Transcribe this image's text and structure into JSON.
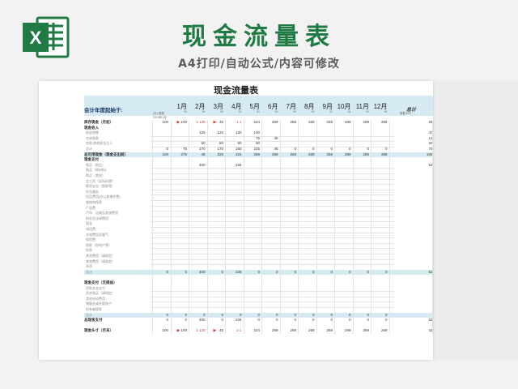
{
  "header": {
    "title": "现金流量表",
    "subtitle": "A4打印/自动公式/内容可修改"
  },
  "sheet": {
    "title": "现金流量表",
    "year_label": "会计年度起始于:",
    "year_sub": "2019年1月",
    "start_col_label": "(月) 数据",
    "start_col_sub": "EST",
    "total_label": "总计",
    "total_sub": "数额 EST",
    "months": [
      "1月",
      "2月",
      "3月",
      "4月",
      "5月",
      "6月",
      "7月",
      "8月",
      "9月",
      "10月",
      "11月",
      "12月"
    ],
    "month_sub": "01",
    "rows": [
      {
        "label": "库存现金（月初）",
        "type": "bold",
        "start": "100",
        "vals": [
          "100",
          "1-125",
          "45",
          "1-1",
          "224",
          "269",
          "269",
          "269",
          "269",
          "269",
          "269",
          "269"
        ],
        "total": "269",
        "red": [
          1,
          3
        ],
        "band": false
      },
      {
        "label": "现金收入",
        "type": "bold",
        "start": "",
        "vals": [],
        "total": "",
        "band": false
      },
      {
        "label": "现金销售",
        "type": "ind",
        "start": "",
        "vals": [
          "",
          "125",
          "120",
          "130",
          "100",
          "",
          "",
          "",
          "",
          "",
          "",
          ""
        ],
        "total": "475",
        "band": false
      },
      {
        "label": "应收账款",
        "type": "ind",
        "start": "",
        "vals": [
          "",
          "",
          "",
          "",
          "75",
          "45",
          "",
          "",
          "",
          "",
          "",
          ""
        ],
        "total": "120",
        "band": false
      },
      {
        "label": "贷款/其他现金注入",
        "type": "ind",
        "start": "",
        "vals": [
          "",
          "50",
          "50",
          "50",
          "50",
          "",
          "",
          "",
          "",
          "",
          "",
          ""
        ],
        "total": "200",
        "band": false
      },
      {
        "label": "总计",
        "type": "ind",
        "start": "0",
        "vals": [
          "75",
          "170",
          "170",
          "160",
          "225",
          "45",
          "0",
          "0",
          "0",
          "0",
          "0",
          "0"
        ],
        "total": "795",
        "band": false
      },
      {
        "label": "总可用现金（现金支出前）",
        "type": "bold",
        "start": "100",
        "vals": [
          "275",
          "45",
          "225",
          "224",
          "269",
          "269",
          "269",
          "269",
          "269",
          "269",
          "269",
          "269"
        ],
        "total": "1064",
        "band": true
      },
      {
        "label": "现金支付",
        "type": "bold",
        "start": "",
        "vals": [],
        "total": "",
        "band": false
      },
      {
        "label": "购买（商品）",
        "type": "ind",
        "start": "",
        "vals": [
          "",
          "400",
          "",
          "226",
          "",
          "",
          "",
          "",
          "",
          "",
          "",
          ""
        ],
        "total": "626",
        "band": false
      },
      {
        "label": "购买（原材料）",
        "type": "ind",
        "start": "",
        "vals": [],
        "total": "0",
        "band": false
      },
      {
        "label": "购买（其他）",
        "type": "ind",
        "start": "",
        "vals": [],
        "total": "0",
        "band": false
      },
      {
        "label": "总工资（实际扣除）",
        "type": "ind",
        "start": "",
        "vals": [],
        "total": "0",
        "band": false
      },
      {
        "label": "薪资支出（税款等）",
        "type": "ind",
        "start": "",
        "vals": [],
        "total": "0",
        "band": false
      },
      {
        "label": "外包服务",
        "type": "ind",
        "start": "",
        "vals": [],
        "total": "0",
        "band": false
      },
      {
        "label": "用品费用(办公和操作费)",
        "type": "ind",
        "start": "",
        "vals": [],
        "total": "0",
        "band": false
      },
      {
        "label": "维修和保养",
        "type": "ind",
        "start": "",
        "vals": [],
        "total": "0",
        "band": false
      },
      {
        "label": "广告费",
        "type": "ind",
        "start": "",
        "vals": [],
        "total": "0",
        "band": false
      },
      {
        "label": "汽车、运输及差旅费用",
        "type": "ind",
        "start": "",
        "vals": [],
        "total": "0",
        "band": false
      },
      {
        "label": "财务及法律费用",
        "type": "ind",
        "start": "",
        "vals": [],
        "total": "0",
        "band": false
      },
      {
        "label": "租金",
        "type": "ind",
        "start": "",
        "vals": [],
        "total": "0",
        "band": false
      },
      {
        "label": "电话费",
        "type": "ind",
        "start": "",
        "vals": [],
        "total": "0",
        "band": false
      },
      {
        "label": "水电费用及暖气",
        "type": "ind",
        "start": "",
        "vals": [],
        "total": "0",
        "band": false
      },
      {
        "label": "保险费",
        "type": "ind",
        "start": "",
        "vals": [],
        "total": "0",
        "band": false
      },
      {
        "label": "税款（房地产等）",
        "type": "ind",
        "start": "",
        "vals": [],
        "total": "0",
        "band": false
      },
      {
        "label": "利息",
        "type": "ind",
        "start": "",
        "vals": [],
        "total": "0",
        "band": false
      },
      {
        "label": "其他费用（请指定）",
        "type": "ind",
        "start": "",
        "vals": [],
        "total": "0",
        "band": false
      },
      {
        "label": "其他费用（请指定）",
        "type": "ind",
        "start": "",
        "vals": [],
        "total": "0",
        "band": false
      },
      {
        "label": "杂项",
        "type": "ind",
        "start": "",
        "vals": [],
        "total": "0",
        "band": false
      },
      {
        "label": "总计",
        "type": "ind",
        "start": "0",
        "vals": [
          "0",
          "400",
          "0",
          "226",
          "0",
          "0",
          "0",
          "0",
          "0",
          "0",
          "0",
          "0"
        ],
        "total": "626",
        "band": true
      },
      {
        "label": "",
        "type": "gap",
        "start": "",
        "vals": [],
        "total": "",
        "band": false
      },
      {
        "label": "现金支付（无损益）",
        "type": "bold",
        "start": "",
        "vals": [],
        "total": "",
        "band": false
      },
      {
        "label": "贷款本金支付",
        "type": "ind",
        "start": "",
        "vals": [],
        "total": "0",
        "band": false
      },
      {
        "label": "资本购买（请指定）",
        "type": "ind",
        "start": "",
        "vals": [],
        "total": "0",
        "band": false
      },
      {
        "label": "其他启动费用",
        "type": "ind",
        "start": "",
        "vals": [],
        "total": "0",
        "band": false
      },
      {
        "label": "储备金或托管账户",
        "type": "ind",
        "start": "",
        "vals": [],
        "total": "0",
        "band": false
      },
      {
        "label": "所有者提款",
        "type": "ind",
        "start": "",
        "vals": [],
        "total": "0",
        "band": false
      },
      {
        "label": "总计",
        "type": "ind",
        "start": "0",
        "vals": [
          "0",
          "0",
          "0",
          "0",
          "0",
          "0",
          "0",
          "0",
          "0",
          "0",
          "0",
          "0"
        ],
        "total": "0",
        "band": true
      },
      {
        "label": "总现金支付",
        "type": "bold",
        "start": "0",
        "vals": [
          "0",
          "400",
          "0",
          "226",
          "0",
          "0",
          "0",
          "0",
          "0",
          "0",
          "0",
          "0"
        ],
        "total": "626",
        "band": false
      },
      {
        "label": "",
        "type": "gap",
        "start": "",
        "vals": [],
        "total": "",
        "band": false
      },
      {
        "label": "现金头寸（月末）",
        "type": "bold",
        "start": "100",
        "vals": [
          "100",
          "1-125",
          "45",
          "1-1",
          "224",
          "269",
          "269",
          "269",
          "269",
          "269",
          "269",
          "269"
        ],
        "total": "436",
        "red": [
          1,
          3
        ],
        "band": false
      }
    ]
  }
}
